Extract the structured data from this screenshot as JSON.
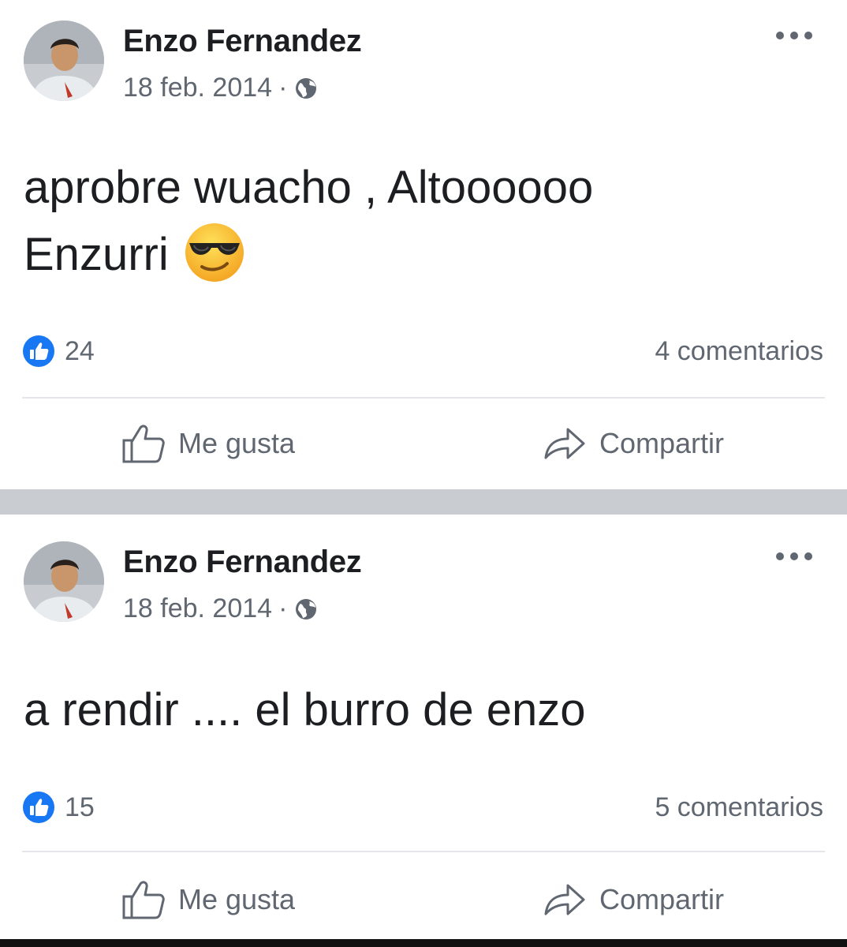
{
  "posts": [
    {
      "author": "Enzo Fernandez",
      "date": "18 feb. 2014",
      "separator": "·",
      "audience_icon": "globe-icon",
      "text_line1": "aprobre wuacho , Altoooooo",
      "text_line2": "Enzurri",
      "emoji": "smiling-face-with-sunglasses",
      "likes": "24",
      "comments": "4 comentarios",
      "like_label": "Me gusta",
      "share_label": "Compartir"
    },
    {
      "author": "Enzo Fernandez",
      "date": "18 feb. 2014",
      "separator": "·",
      "audience_icon": "globe-icon",
      "text_line1": "a rendir .... el burro de enzo",
      "likes": "15",
      "comments": "5 comentarios",
      "like_label": "Me gusta",
      "share_label": "Compartir"
    }
  ],
  "colors": {
    "facebook_blue": "#1877f2",
    "secondary_text": "#606770",
    "primary_text": "#1c1e21",
    "separator": "#c9ccd1"
  }
}
